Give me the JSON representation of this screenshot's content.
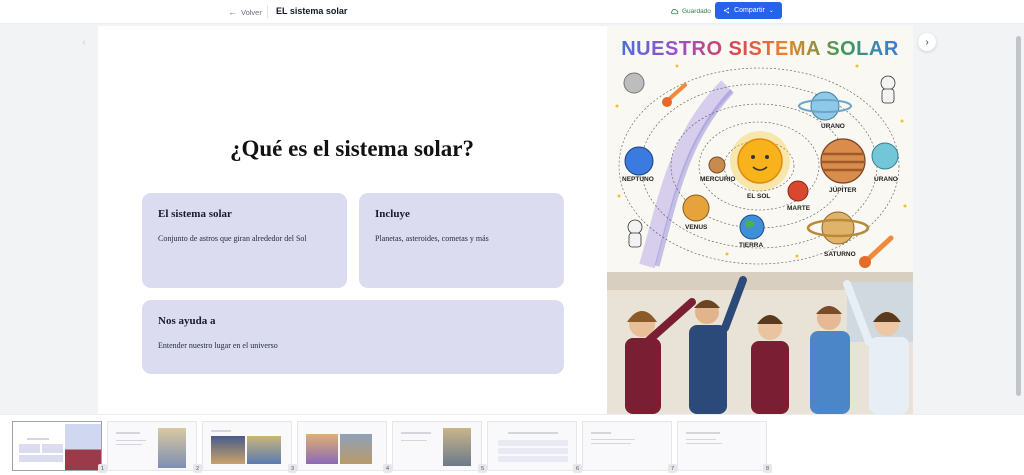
{
  "topbar": {
    "back_label": "Volver",
    "doc_title": "EL sistema solar",
    "saved_label": "Guardado",
    "share_label": "Compartir"
  },
  "slide": {
    "title": "¿Qué es el sistema solar?",
    "cards": [
      {
        "heading": "El sistema solar",
        "text": "Conjunto de astros que giran alrededor del Sol"
      },
      {
        "heading": "Incluye",
        "text": "Planetas, asteroides, cometas y más"
      },
      {
        "heading": "Nos ayuda a",
        "text": "Entender nuestro lugar en el universo"
      }
    ],
    "poster": {
      "title": "NUESTRO SISTEMA SOLAR",
      "labels": {
        "urano_top": "URANO",
        "neptuno": "NEPTUNO",
        "mercurio": "MERCURIO",
        "el_sol": "EL SOL",
        "marte": "MARTE",
        "jupiter": "JÚPITER",
        "urano_right": "URANO",
        "venus": "VENUS",
        "tierra": "TIERRA",
        "saturno": "SATURNO"
      }
    }
  },
  "thumbnails": {
    "numbers": [
      "1",
      "2",
      "3",
      "4",
      "5",
      "6",
      "7",
      "8"
    ]
  },
  "colors": {
    "accent": "#2563eb",
    "card_bg": "#dcdcf0",
    "saved": "#2f7d4f"
  }
}
